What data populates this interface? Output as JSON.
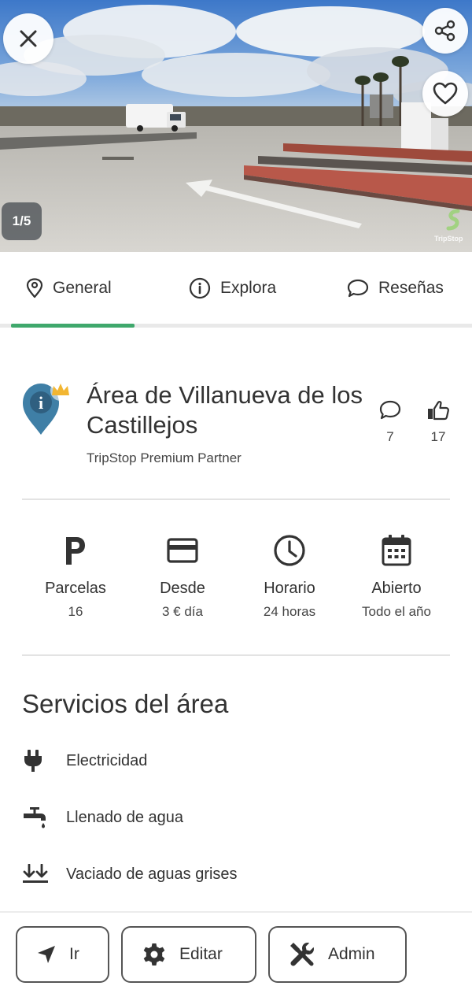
{
  "hero": {
    "counter": "1/5",
    "watermark": "TripStop"
  },
  "tabs": [
    {
      "label": "General",
      "icon": "location-pin-icon",
      "active": true
    },
    {
      "label": "Explora",
      "icon": "info-circle-icon",
      "active": false
    },
    {
      "label": "Reseñas",
      "icon": "speech-bubble-icon",
      "active": false
    }
  ],
  "place": {
    "title": "Área de Villanueva de los Castillejos",
    "subtitle": "TripStop Premium Partner",
    "comments_count": "7",
    "likes_count": "17"
  },
  "info": [
    {
      "icon": "parking-icon",
      "label": "Parcelas",
      "value": "16"
    },
    {
      "icon": "credit-card-icon",
      "label": "Desde",
      "value": "3 € día"
    },
    {
      "icon": "clock-icon",
      "label": "Horario",
      "value": "24 horas"
    },
    {
      "icon": "calendar-icon",
      "label": "Abierto",
      "value": "Todo el año"
    }
  ],
  "services": {
    "title": "Servicios del área",
    "items": [
      {
        "icon": "electric-plug-icon",
        "label": "Electricidad"
      },
      {
        "icon": "water-tap-icon",
        "label": "Llenado de agua"
      },
      {
        "icon": "drain-arrows-icon",
        "label": "Vaciado de aguas grises"
      }
    ]
  },
  "actions": {
    "go": "Ir",
    "edit": "Editar",
    "admin": "Admin"
  },
  "colors": {
    "accent": "#3fa86c",
    "pin_blue": "#3f7fa6",
    "crown": "#f2b632",
    "text": "#333333"
  }
}
